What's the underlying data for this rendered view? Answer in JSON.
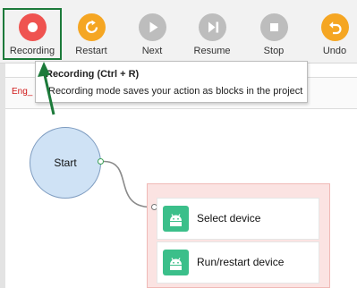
{
  "toolbar": {
    "buttons": [
      {
        "label": "Recording",
        "color": "#ef5350",
        "icon": "record-icon"
      },
      {
        "label": "Restart",
        "color": "#f5a623",
        "icon": "restart-icon"
      },
      {
        "label": "Next",
        "color": "#bdbdbd",
        "icon": "play-icon"
      },
      {
        "label": "Resume",
        "color": "#bdbdbd",
        "icon": "resume-icon"
      },
      {
        "label": "Stop",
        "color": "#bdbdbd",
        "icon": "stop-icon"
      },
      {
        "label": "Undo",
        "color": "#f5a623",
        "icon": "undo-icon"
      }
    ]
  },
  "tab": {
    "label": "Eng_"
  },
  "tooltip": {
    "title": "Recording (Ctrl + R)",
    "description": "Recording mode saves your action as blocks in the project"
  },
  "canvas": {
    "start_label": "Start",
    "blocks": [
      {
        "label": "Select device",
        "icon": "android-icon"
      },
      {
        "label": "Run/restart device",
        "icon": "android-icon"
      }
    ]
  },
  "colors": {
    "highlight": "#1c7a3a",
    "start_node": "#cfe2f5",
    "group_bg": "#fbe3e2",
    "block_icon": "#3bbf8a"
  }
}
